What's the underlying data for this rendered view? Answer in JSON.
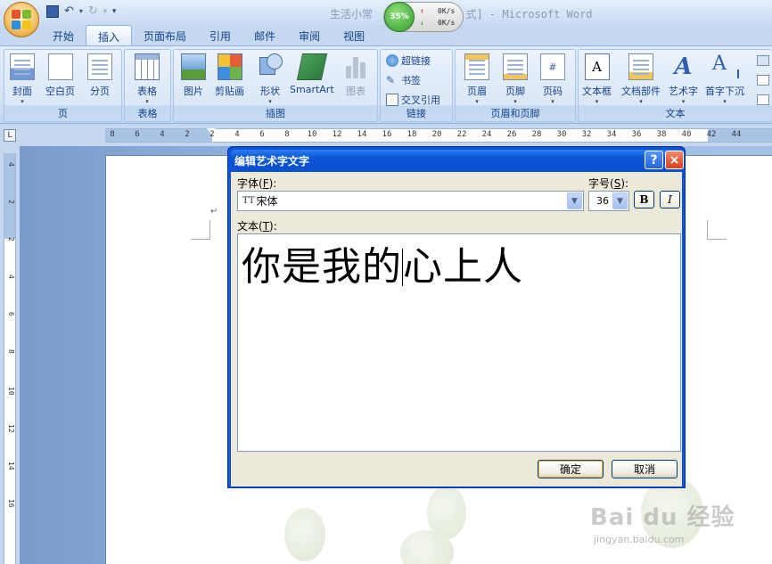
{
  "window": {
    "title_left": "生活小常",
    "title_right": "式] - Microsoft Word"
  },
  "quick_access": {
    "save_icon": "save-icon",
    "undo_icon": "undo-icon",
    "redo_icon": "redo-icon"
  },
  "net_widget": {
    "cpu": "35%",
    "upload": "0K/s",
    "download": "0K/s"
  },
  "tabs": [
    "开始",
    "插入",
    "页面布局",
    "引用",
    "邮件",
    "审阅",
    "视图"
  ],
  "active_tab": "插入",
  "ribbon": {
    "pages": {
      "label": "页",
      "buttons": [
        "封面",
        "空白页",
        "分页"
      ]
    },
    "tables": {
      "label": "表格",
      "buttons": [
        "表格"
      ]
    },
    "illustrations": {
      "label": "插图",
      "buttons": [
        "图片",
        "剪贴画",
        "形状",
        "SmartArt",
        "图表"
      ]
    },
    "links": {
      "label": "链接",
      "buttons": [
        "超链接",
        "书签",
        "交叉引用"
      ]
    },
    "header_footer": {
      "label": "页眉和页脚",
      "buttons": [
        "页眉",
        "页脚",
        "页码"
      ]
    },
    "text": {
      "label": "文本",
      "buttons": [
        "文本框",
        "文档部件",
        "艺术字",
        "首字下沉"
      ]
    }
  },
  "ruler": {
    "corner": "L",
    "h_numbers": [
      "8",
      "6",
      "4",
      "2",
      "2",
      "4",
      "6",
      "8",
      "10",
      "12",
      "14",
      "16",
      "18",
      "20",
      "22",
      "24",
      "26",
      "28",
      "30",
      "32",
      "34",
      "36",
      "38",
      "40",
      "42",
      "44"
    ],
    "v_numbers": [
      "4",
      "2",
      "2",
      "4",
      "6",
      "8",
      "10",
      "12",
      "14",
      "16"
    ]
  },
  "dialog": {
    "title": "编辑艺术字文字",
    "help": "?",
    "close": "×",
    "font_label_text": "字体",
    "font_label_key": "F",
    "font_value": "宋体",
    "size_label_text": "字号",
    "size_label_key": "S",
    "size_value": "36",
    "bold_label": "B",
    "italic_label": "I",
    "text_label_text": "文本",
    "text_label_key": "T",
    "text_before_cursor": "你是我的",
    "text_after_cursor": "心上人",
    "ok_label": "确定",
    "cancel_label": "取消"
  },
  "watermark": {
    "logo": "Bai du 经验",
    "url": "jingyan.baidu.com"
  },
  "colors": {
    "dialog_title": "#0a54d8",
    "ribbon_text": "#15428b",
    "workspace": "#8fb0dd"
  }
}
